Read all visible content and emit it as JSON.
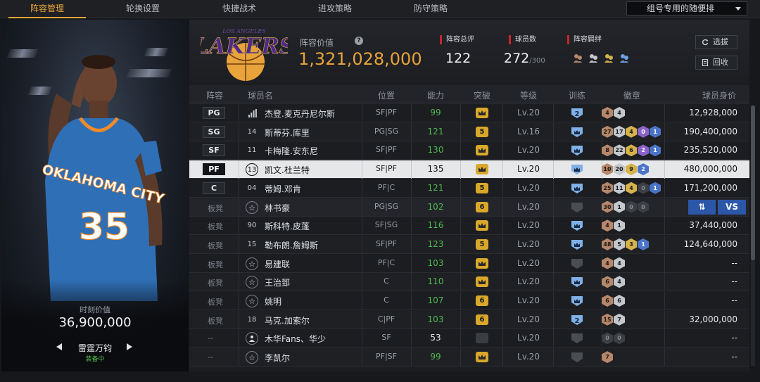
{
  "nav": {
    "tabs": [
      "阵容管理",
      "轮换设置",
      "快捷战术",
      "进攻策略",
      "防守策略"
    ],
    "active_tab": 0,
    "dropdown_value": "组号专用的随便排"
  },
  "left_panel": {
    "jersey_text": "OKLAHOMA CITY",
    "jersey_number": "35",
    "market_value_label": "时刻价值",
    "market_value": "36,900,000",
    "player_name": "雷霆万钧",
    "status": "装备中"
  },
  "header": {
    "logo_team": "LAKERS",
    "logo_city": "LOS ANGELES",
    "team_value_label": "阵容价值",
    "team_value": "1,321,028,000",
    "overall_label": "阵容总评",
    "overall_value": "122",
    "roster_label": "球员数",
    "roster_value": "272",
    "roster_max": "/300",
    "bond_label": "阵容羁绊",
    "bond_icons": [
      "bond-bronze-icon",
      "bond-silver-icon",
      "bond-gold-icon",
      "bond-blue-icon"
    ],
    "select_button": "选拔",
    "recycle_button": "回收"
  },
  "columns": [
    "阵容",
    "球员名",
    "位置",
    "能力",
    "突破",
    "等级",
    "训练",
    "徽章",
    "球员身价"
  ],
  "rows": [
    {
      "slot": "PG",
      "num": "",
      "num_type": "bars",
      "name": "杰登.麦克丹尼尔斯",
      "pos": "SF|PF",
      "ability": "99",
      "break": "crown",
      "level": "Lv.20",
      "train": "2",
      "badges": [
        [
          "4",
          "br"
        ],
        [
          "4",
          "sv"
        ]
      ],
      "value": "12,928,000"
    },
    {
      "slot": "SG",
      "num": "14",
      "num_type": "plain",
      "name": "斯蒂芬.库里",
      "pos": "PG|SG",
      "ability": "121",
      "break": "5",
      "level": "Lv.16",
      "train": "crown",
      "badges": [
        [
          "27",
          "br"
        ],
        [
          "17",
          "sv"
        ],
        [
          "4",
          "gd"
        ],
        [
          "0",
          "pu"
        ],
        [
          "1",
          "bl"
        ]
      ],
      "value": "190,400,000"
    },
    {
      "slot": "SF",
      "num": "11",
      "num_type": "plain",
      "name": "卡梅隆.安东尼",
      "pos": "SF|PF",
      "ability": "130",
      "break": "crown",
      "level": "Lv.20",
      "train": "crown",
      "badges": [
        [
          "8",
          "br"
        ],
        [
          "22",
          "sv"
        ],
        [
          "6",
          "gd"
        ],
        [
          "2",
          "pu"
        ],
        [
          "1",
          "bl"
        ]
      ],
      "value": "235,520,000"
    },
    {
      "slot": "PF",
      "num": "13",
      "num_type": "circle",
      "name": "凯文.杜兰特",
      "pos": "SF|PF",
      "ability": "135",
      "break": "crown",
      "level": "Lv.20",
      "train": "crown",
      "badges": [
        [
          "10",
          "br"
        ],
        [
          "20",
          "sv"
        ],
        [
          "9",
          "gd"
        ],
        [
          "2",
          "bl"
        ]
      ],
      "value": "480,000,000",
      "selected": true
    },
    {
      "slot": "C",
      "num": "04",
      "num_type": "plain",
      "name": "蒂姆.邓肯",
      "pos": "PF|C",
      "ability": "121",
      "break": "5",
      "level": "Lv.20",
      "train": "crown",
      "badges": [
        [
          "25",
          "br"
        ],
        [
          "11",
          "sv"
        ],
        [
          "4",
          "gd"
        ],
        [
          "0",
          "dk"
        ],
        [
          "1",
          "bl"
        ]
      ],
      "value": "171,200,000"
    },
    {
      "slot": "板凳",
      "num": "",
      "num_type": "star",
      "name": "林书豪",
      "pos": "PG|SG",
      "ability": "102",
      "break": "6",
      "level": "Lv.20",
      "train": "gray",
      "badges": [
        [
          "30",
          "br"
        ],
        [
          "1",
          "sv"
        ],
        [
          "0",
          "dk"
        ],
        [
          "0",
          "dk"
        ]
      ],
      "value": "",
      "vs": true
    },
    {
      "slot": "板凳",
      "num": "90",
      "num_type": "plain",
      "name": "斯科特.皮蓬",
      "pos": "SF|SG",
      "ability": "116",
      "break": "crown",
      "level": "Lv.20",
      "train": "crown",
      "badges": [
        [
          "4",
          "br"
        ],
        [
          "1",
          "sv"
        ]
      ],
      "value": "37,440,000"
    },
    {
      "slot": "板凳",
      "num": "15",
      "num_type": "plain",
      "name": "勒布朗.詹姆斯",
      "pos": "SF|PF",
      "ability": "123",
      "break": "5",
      "level": "Lv.20",
      "train": "crown",
      "badges": [
        [
          "48",
          "br"
        ],
        [
          "5",
          "sv"
        ],
        [
          "3",
          "gd"
        ],
        [
          "1",
          "bl"
        ]
      ],
      "value": "124,640,000"
    },
    {
      "slot": "板凳",
      "num": "",
      "num_type": "star",
      "name": "易建联",
      "pos": "PF|C",
      "ability": "103",
      "break": "crown",
      "level": "Lv.20",
      "train": "gray",
      "badges": [
        [
          "4",
          "br"
        ],
        [
          "4",
          "sv"
        ]
      ],
      "value": "--"
    },
    {
      "slot": "板凳",
      "num": "",
      "num_type": "star",
      "name": "王治郅",
      "pos": "C",
      "ability": "110",
      "break": "crown",
      "level": "Lv.20",
      "train": "crown",
      "badges": [
        [
          "6",
          "br"
        ],
        [
          "4",
          "sv"
        ]
      ],
      "value": "--"
    },
    {
      "slot": "板凳",
      "num": "",
      "num_type": "star",
      "name": "姚明",
      "pos": "C",
      "ability": "107",
      "break": "6",
      "level": "Lv.20",
      "train": "crown",
      "badges": [
        [
          "6",
          "br"
        ],
        [
          "6",
          "sv"
        ]
      ],
      "value": "--"
    },
    {
      "slot": "板凳",
      "num": "18",
      "num_type": "plain",
      "name": "马克.加索尔",
      "pos": "C|PF",
      "ability": "103",
      "break": "6",
      "level": "Lv.20",
      "train": "2",
      "badges": [
        [
          "15",
          "br"
        ],
        [
          "7",
          "sv"
        ]
      ],
      "value": "32,000,000"
    },
    {
      "slot": "--",
      "num": "",
      "num_type": "person",
      "name": "木华Fans、华少",
      "pos": "SF",
      "ability": "53",
      "ability_white": true,
      "break": "gray",
      "level": "Lv.20",
      "train": "gray",
      "badges": [
        [
          "0",
          "dk"
        ],
        [
          "0",
          "dk"
        ]
      ],
      "value": "--"
    },
    {
      "slot": "--",
      "num": "",
      "num_type": "star",
      "name": "李凯尔",
      "pos": "PF|SF",
      "ability": "99",
      "break": "crown",
      "level": "Lv.20",
      "train": "gray",
      "badges": [
        [
          "7",
          "br"
        ]
      ],
      "value": "--"
    }
  ],
  "vs_buttons": {
    "swap": "⇅",
    "vs": "VS"
  },
  "colors": {
    "accent": "#e8a33a",
    "green": "#4fb84f",
    "red": "#c8262a",
    "blue": "#2c56a8"
  }
}
